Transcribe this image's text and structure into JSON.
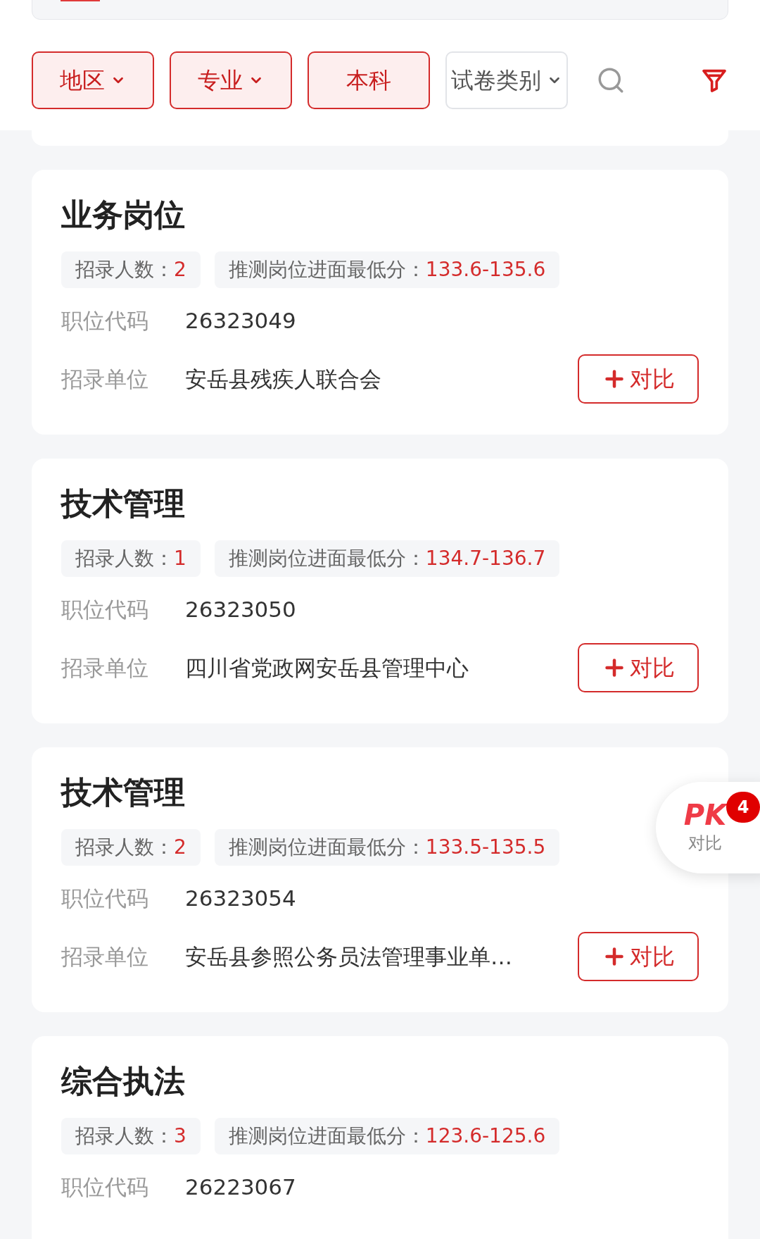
{
  "filters": [
    {
      "label": "地区",
      "dropdown": true,
      "selected": true
    },
    {
      "label": "专业",
      "dropdown": true,
      "selected": true
    },
    {
      "label": "本科",
      "dropdown": false,
      "selected": true
    },
    {
      "label": "试卷类别",
      "dropdown": true,
      "selected": false
    }
  ],
  "positions": [
    {
      "title": "业务岗位",
      "count_label": "招录人数：",
      "count": "2",
      "score_label": "推测岗位进面最低分：",
      "score": "133.6-135.6",
      "code_label": "职位代码",
      "code": "26323049",
      "unit_label": "招录单位",
      "unit": "安岳县残疾人联合会",
      "compare": "对比"
    },
    {
      "title": "技术管理",
      "count_label": "招录人数：",
      "count": "1",
      "score_label": "推测岗位进面最低分：",
      "score": "134.7-136.7",
      "code_label": "职位代码",
      "code": "26323050",
      "unit_label": "招录单位",
      "unit": "四川省党政网安岳县管理中心",
      "compare": "对比"
    },
    {
      "title": "技术管理",
      "count_label": "招录人数：",
      "count": "2",
      "score_label": "推测岗位进面最低分：",
      "score": "133.5-135.5",
      "code_label": "职位代码",
      "code": "26323054",
      "unit_label": "招录单位",
      "unit": "安岳县参照公务员法管理事业单…",
      "compare": "对比"
    },
    {
      "title": "综合执法",
      "count_label": "招录人数：",
      "count": "3",
      "score_label": "推测岗位进面最低分：",
      "score": "123.6-125.6",
      "code_label": "职位代码",
      "code": "26223067"
    }
  ],
  "pk": {
    "logo": "PK",
    "badge": "4",
    "label": "对比"
  }
}
